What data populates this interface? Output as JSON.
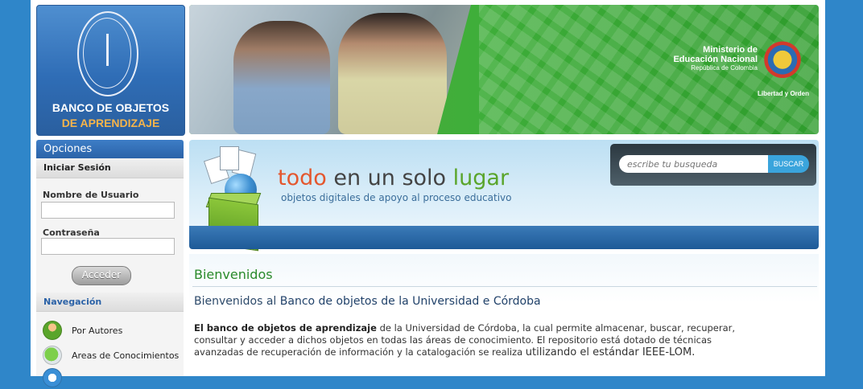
{
  "logo": {
    "line1": "BANCO DE OBJETOS",
    "line2": "DE APRENDIZAJE"
  },
  "banner": {
    "ministerio_line1": "Ministerio de",
    "ministerio_line2": "Educación Nacional",
    "ministerio_line3": "República de Colombia",
    "motto": "Libertad y Orden"
  },
  "sidebar": {
    "header": "Opciones",
    "login_header": "Iniciar Sesión",
    "username_label": "Nombre de Usuario",
    "username_value": "",
    "password_label": "Contraseña",
    "password_value": "",
    "submit_label": "Acceder",
    "nav_header": "Navegación",
    "nav_items": [
      {
        "label": "Por Autores",
        "icon": "user-icon"
      },
      {
        "label": "Areas de Conocimientos",
        "icon": "puzzle-icon"
      },
      {
        "label": "",
        "icon": "document-icon"
      }
    ]
  },
  "hero": {
    "tag_todo": "todo",
    "tag_mid": " en un solo ",
    "tag_lugar": "lugar",
    "subline": "objetos digitales de apoyo al proceso educativo",
    "search_placeholder": "escribe tu busqueda",
    "search_button": "BUSCAR"
  },
  "content": {
    "title": "Bienvenidos",
    "welcome_prefix": "Bienvenidos al ",
    "welcome_strong": "Banco de objetos de la Universidad e Córdoba",
    "para_bold": "El banco de objetos de aprendizaje",
    "para_text": " de la Universidad de Córdoba, la cual permite almacenar, buscar, recuperar, consultar y acceder a dichos objetos en todas las áreas de conocimiento. El repositorio está dotado de técnicas avanzadas de recuperación de información y la catalogación se realiza ",
    "para_bigger": "utilizando el estándar IEEE-LOM."
  },
  "colors": {
    "background": "#2f86c9",
    "accent_green": "#5aa52b",
    "accent_orange": "#e4572e",
    "title_green": "#2a8a2a"
  }
}
